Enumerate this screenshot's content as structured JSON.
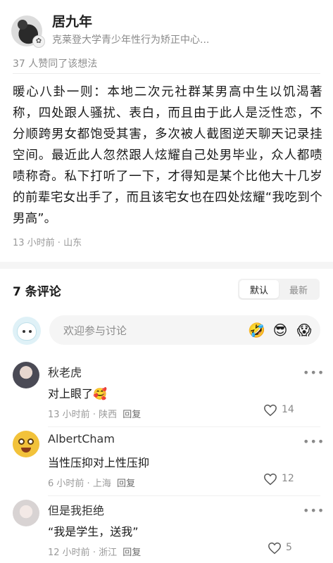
{
  "author": {
    "name": "居九年",
    "bio": "克莱登大学青少年性行为矫正中心...",
    "badge_icon": "badge-icon"
  },
  "likes_text": "37 人赞同了该想法",
  "post": {
    "body": "暖心八卦一则：本地二次元社群某男高中生以饥渴著称，四处跟人骚扰、表白，而且由于此人是泛性恋，不分顺跨男女都饱受其害，多次被人截图逆天聊天记录挂空间。最近此人忽然跟人炫耀自己处男毕业，众人都啧啧称奇。私下打听了一下，才得知是某个比他大十几岁的前辈宅女出手了，而且该宅女也在四处炫耀“我吃到个男高”。",
    "meta": "13 小时前 · 山东"
  },
  "comments_section": {
    "title": "7 条评论",
    "sort_options": [
      "默认",
      "最新"
    ],
    "active_sort": "默认",
    "compose_placeholder": "欢迎参与讨论",
    "quick_emojis": [
      "🤣",
      "😎",
      "😱"
    ]
  },
  "comments": [
    {
      "name": "秋老虎",
      "text": "对上眼了🥰",
      "time": "13 小时前",
      "location": "陕西",
      "reply_label": "回复",
      "likes": "14",
      "more": "•••"
    },
    {
      "name": "AlbertCham",
      "text": "当性压抑对上性压抑",
      "time": "6 小时前",
      "location": "上海",
      "reply_label": "回复",
      "likes": "12",
      "more": "•••"
    },
    {
      "name": "但是我拒绝",
      "text": "“我是学生，送我”",
      "time": "12 小时前",
      "location": "浙江",
      "reply_label": "回复",
      "likes": "5",
      "more": "•••"
    }
  ],
  "colors": {
    "text_primary": "#1a1a1a",
    "text_secondary": "#9a9a9a",
    "band": "#f5f5f5"
  }
}
